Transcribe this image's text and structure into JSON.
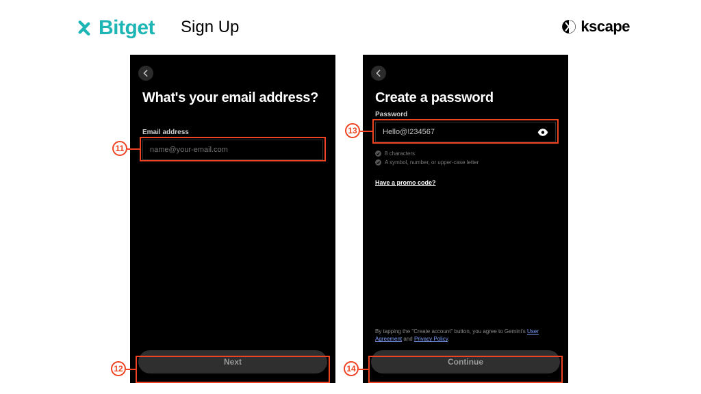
{
  "header": {
    "brand": "Bitget",
    "page_title": "Sign Up",
    "attribution": "kscape"
  },
  "screen_email": {
    "title": "What's your email address?",
    "field_label": "Email address",
    "placeholder": "name@your-email.com",
    "value": "",
    "cta": "Next"
  },
  "screen_password": {
    "title": "Create a password",
    "field_label": "Password",
    "value": "Hello@!234567",
    "requirements": [
      "8 characters",
      "A symbol, number, or upper-case letter"
    ],
    "promo_link": "Have a promo code?",
    "agree_prefix": "By tapping the \"Create account\" button, you agree to Gemini's ",
    "agree_link1": "User Agreement",
    "agree_mid": " and ",
    "agree_link2": "Privacy Policy",
    "agree_suffix": ".",
    "cta": "Continue"
  },
  "annotations": {
    "n11": "11",
    "n12": "12",
    "n13": "13",
    "n14": "14"
  }
}
